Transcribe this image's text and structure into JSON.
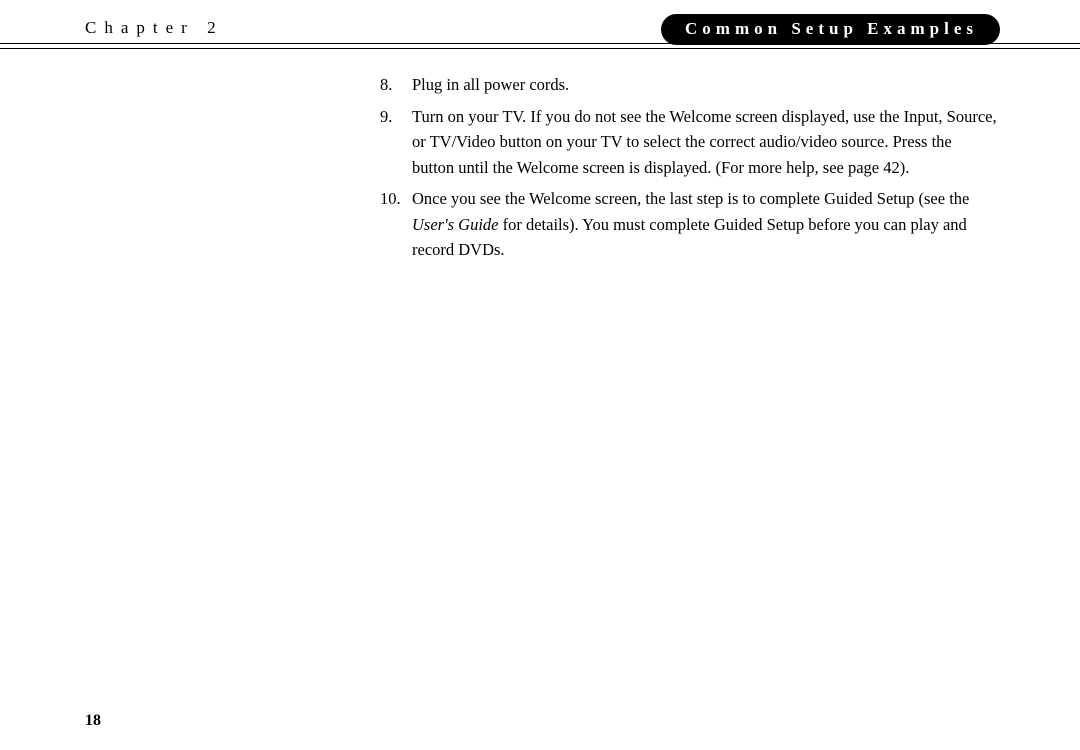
{
  "header": {
    "chapter_label": "Chapter 2",
    "section_title": "Common Setup Examples"
  },
  "steps": [
    {
      "num": "8.",
      "text": "Plug in all power cords."
    },
    {
      "num": "9.",
      "text": "Turn on your TV. If you do not see the Welcome screen displayed, use the Input, Source, or TV/Video button on your TV to select the correct audio/video source. Press the button until the Welcome screen is displayed. (For more help, see page 42)."
    },
    {
      "num": "10.",
      "pre": "Once you see the Welcome screen, the last step is to complete Guided Setup (see the ",
      "italic": "User's Guide",
      "post": " for details). You must complete Guided Setup before you can play and record DVDs."
    }
  ],
  "page_number": "18"
}
